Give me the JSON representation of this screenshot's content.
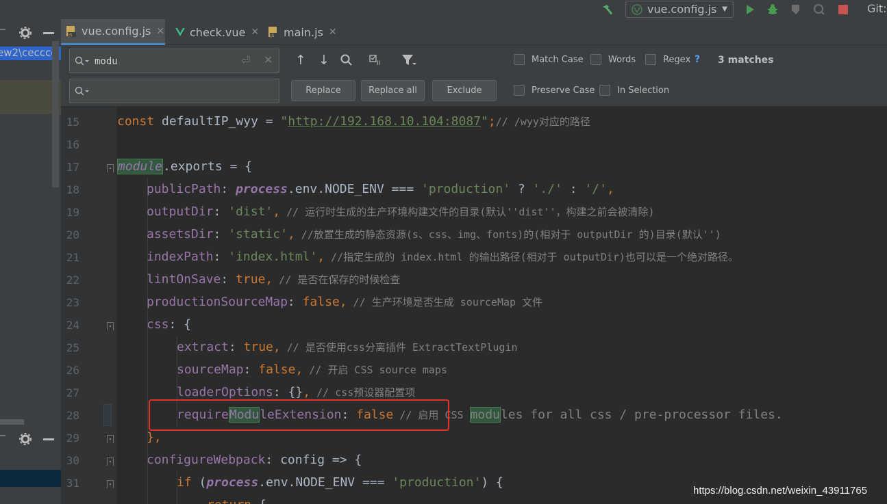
{
  "toolbar": {
    "run_config": "vue.config.js",
    "git_label": "Git:"
  },
  "left_panel": {
    "path_text": "ew2\\cecccc"
  },
  "tabs": [
    {
      "label": "vue.config.js",
      "icon": "js-file-icon",
      "active": true
    },
    {
      "label": "check.vue",
      "icon": "vue-file-icon",
      "active": false
    },
    {
      "label": "main.js",
      "icon": "js-file-icon",
      "active": false
    }
  ],
  "find": {
    "query": "modu",
    "replace_value": "",
    "buttons": {
      "replace": "Replace",
      "replace_all": "Replace all",
      "exclude": "Exclude"
    },
    "options": {
      "match_case": "Match Case",
      "words": "Words",
      "regex": "Regex",
      "help": "?",
      "preserve_case": "Preserve Case",
      "in_selection": "In Selection"
    },
    "matches": "3 matches"
  },
  "editor": {
    "line_numbers": [
      "15",
      "16",
      "17",
      "18",
      "19",
      "20",
      "21",
      "22",
      "23",
      "24",
      "25",
      "26",
      "27",
      "28",
      "29",
      "30",
      "31"
    ],
    "lines": {
      "l15": {
        "kw": "const",
        "name": " defaultIP_wyy = ",
        "q1": "\"",
        "url": "http://192.168.10.104:8087",
        "q2": "\"",
        "semi": ";",
        "cm": "// /wyy对应的路径"
      },
      "l17": {
        "glob": "module",
        "rest": ".exports = {"
      },
      "l18": {
        "prop": "publicPath",
        "p1": ": ",
        "glob": "process",
        "p2": ".env.NODE_ENV === ",
        "s1": "'production'",
        "p3": " ? ",
        "s2": "'./'",
        "p4": " : ",
        "s3": "'/'",
        "comma": ","
      },
      "l19": {
        "prop": "outputDir",
        "p1": ": ",
        "s1": "'dist'",
        "comma": ",",
        "cm": " // 运行时生成的生产环境构建文件的目录(默认''dist''，构建之前会被清除)"
      },
      "l20": {
        "prop": "assetsDir",
        "p1": ": ",
        "s1": "'static'",
        "comma": ",",
        "cm": " //放置生成的静态资源(s、css、img、fonts)的(相对于 outputDir 的)目录(默认'')"
      },
      "l21": {
        "prop": "indexPath",
        "p1": ": ",
        "s1": "'index.html'",
        "comma": ",",
        "cm": " //指定生成的 index.html 的输出路径(相对于 outputDir)也可以是一个绝对路径。"
      },
      "l22": {
        "prop": "lintOnSave",
        "p1": ": ",
        "kw": "true",
        "comma": ",",
        "cm": " // 是否在保存的时候检查"
      },
      "l23": {
        "prop": "productionSourceMap",
        "p1": ": ",
        "kw": "false",
        "comma": ",",
        "cm": " // 生产环境是否生成 sourceMap 文件"
      },
      "l24": {
        "prop": "css",
        "p1": ": {"
      },
      "l25": {
        "prop": "extract",
        "p1": ": ",
        "kw": "true",
        "comma": ",",
        "cm": " // 是否使用css分离插件 ExtractTextPlugin"
      },
      "l26": {
        "prop": "sourceMap",
        "p1": ": ",
        "kw": "false",
        "comma": ",",
        "cm": " // 开启 CSS source maps"
      },
      "l27": {
        "prop": "loaderOptions",
        "p1": ": {}",
        "comma": ",",
        "cm": " // css预设器配置项"
      },
      "l28": {
        "prop_a": "require",
        "prop_hl": "Modu",
        "prop_b": "leExtension",
        "p1": ": ",
        "kw": "false",
        "cm_a": " // 启用 CSS ",
        "cm_hl": "modu",
        "cm_b": "les for all css / pre-processor files."
      },
      "l29": {
        "text": "},"
      },
      "l30": {
        "prop": "configureWebpack",
        "p1": ": config => {"
      },
      "l31": {
        "kw": "if",
        "p1": " (",
        "glob": "process",
        "p2": ".env.NODE_ENV === ",
        "s1": "'production'",
        "p3": ") {"
      },
      "l32": {
        "kw": "return",
        "p1": " {"
      }
    }
  },
  "watermark": "https://blog.csdn.net/weixin_43911765"
}
